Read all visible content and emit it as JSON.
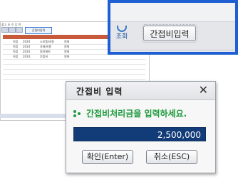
{
  "background_window": {
    "title": "출고 요 수 입 력",
    "tab_label": "간접비입력",
    "rows": [
      {
        "c1": "직접",
        "c2": "2024",
        "c3": "소모품/비용",
        "c4": "원재"
      },
      {
        "c1": "직접",
        "c2": "2024",
        "c3": "자재/비용",
        "c4": "원재"
      },
      {
        "c1": "직접",
        "c2": "2024",
        "c3": "원자재비",
        "c4": "원재"
      },
      {
        "c1": "직접",
        "c2": "2024",
        "c3": "부품비",
        "c4": "원재"
      }
    ]
  },
  "zoom_panel": {
    "lookup_icon_label": "조회",
    "indirect_cost_button_label": "간접비입력"
  },
  "dialog": {
    "title": "간접비 입력",
    "close_glyph": "✕",
    "message": "간접비처리금을 입력하세요.",
    "amount_value": "2,500,000",
    "ok_button_label": "확인(Enter)",
    "cancel_button_label": "취소(ESC)"
  },
  "colors": {
    "callout_border": "#1f5fd4",
    "message_text": "#1c9a3c",
    "amount_field_bg": "#123c78"
  }
}
